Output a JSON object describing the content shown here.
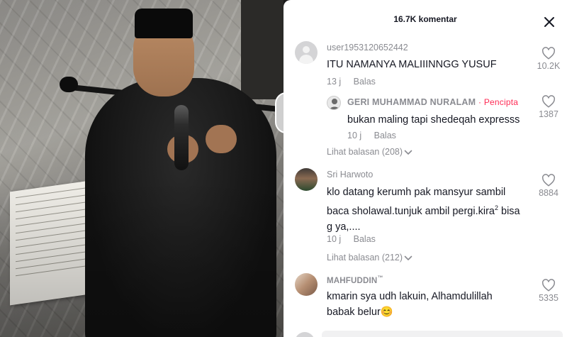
{
  "header": {
    "comment_count": "16.7K komentar"
  },
  "icons": {
    "close": "close-icon",
    "like": "heart-outline-icon",
    "expand": "chevron-down-icon"
  },
  "colors": {
    "creator_tag": "#fe2c55",
    "secondary_text": "#8a8b91",
    "primary_text": "#161823"
  },
  "comments": [
    {
      "username": "user1953120652442",
      "text": "ITU NAMANYA MALIIINNGG YUSUF",
      "time": "13 j",
      "reply_label": "Balas",
      "likes": "10.2K",
      "reply": {
        "username": "GERI MUHAMMAD NURALAM",
        "creator_sep": "·",
        "creator_label": "Pencipta",
        "text": "bukan maling tapi shedeqah expresss",
        "time": "10 j",
        "reply_label": "Balas",
        "likes": "1387"
      },
      "view_replies": "Lihat balasan (208)"
    },
    {
      "username": "Sri Harwoto",
      "text_line1": "klo datang kerumh pak mansyur sambil",
      "text_line2_pre": "baca sholawal.tunjuk ambil pergi.kira",
      "text_line2_sup": "2",
      "text_line2_post": " bisa",
      "text_line3": "g ya,....",
      "time": "10 j",
      "reply_label": "Balas",
      "likes": "8884",
      "view_replies": "Lihat balasan (212)"
    },
    {
      "username": "MAHFUDDIN",
      "username_mark": "™",
      "text_line1": "kmarin sya udh lakuin, Alhamdulillah",
      "text_line2": "babak belur",
      "emoji": "😊",
      "likes": "5335"
    }
  ]
}
